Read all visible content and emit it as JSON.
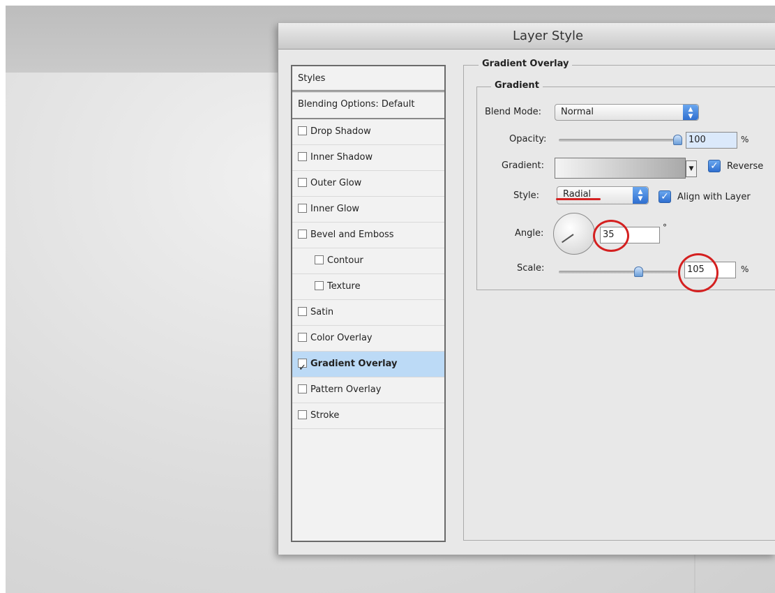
{
  "dialog": {
    "title": "Layer Style"
  },
  "styles_panel": {
    "header": "Styles",
    "blending": "Blending Options: Default",
    "items": [
      {
        "label": "Drop Shadow",
        "checked": false,
        "indent": false,
        "selected": false
      },
      {
        "label": "Inner Shadow",
        "checked": false,
        "indent": false,
        "selected": false
      },
      {
        "label": "Outer Glow",
        "checked": false,
        "indent": false,
        "selected": false
      },
      {
        "label": "Inner Glow",
        "checked": false,
        "indent": false,
        "selected": false
      },
      {
        "label": "Bevel and Emboss",
        "checked": false,
        "indent": false,
        "selected": false
      },
      {
        "label": "Contour",
        "checked": false,
        "indent": true,
        "selected": false
      },
      {
        "label": "Texture",
        "checked": false,
        "indent": true,
        "selected": false
      },
      {
        "label": "Satin",
        "checked": false,
        "indent": false,
        "selected": false
      },
      {
        "label": "Color Overlay",
        "checked": false,
        "indent": false,
        "selected": false
      },
      {
        "label": "Gradient Overlay",
        "checked": true,
        "indent": false,
        "selected": true
      },
      {
        "label": "Pattern Overlay",
        "checked": false,
        "indent": false,
        "selected": false
      },
      {
        "label": "Stroke",
        "checked": false,
        "indent": false,
        "selected": false
      }
    ]
  },
  "settings": {
    "group_title": "Gradient Overlay",
    "subgroup_title": "Gradient",
    "blend_mode": {
      "label": "Blend Mode:",
      "value": "Normal"
    },
    "opacity": {
      "label": "Opacity:",
      "value": "100",
      "unit": "%",
      "fraction": 1.0
    },
    "gradient": {
      "label": "Gradient:",
      "reverse_label": "Reverse",
      "reverse_checked": true
    },
    "style": {
      "label": "Style:",
      "value": "Radial",
      "align_label": "Align with Layer",
      "align_checked": true
    },
    "angle": {
      "label": "Angle:",
      "value": "35",
      "unit": "°"
    },
    "scale": {
      "label": "Scale:",
      "value": "105",
      "unit": "%",
      "fraction": 0.67
    }
  },
  "colors": {
    "selection": "#bcdaf6",
    "highlight_circle": "#d42020",
    "accent": "#2f6fd0"
  }
}
